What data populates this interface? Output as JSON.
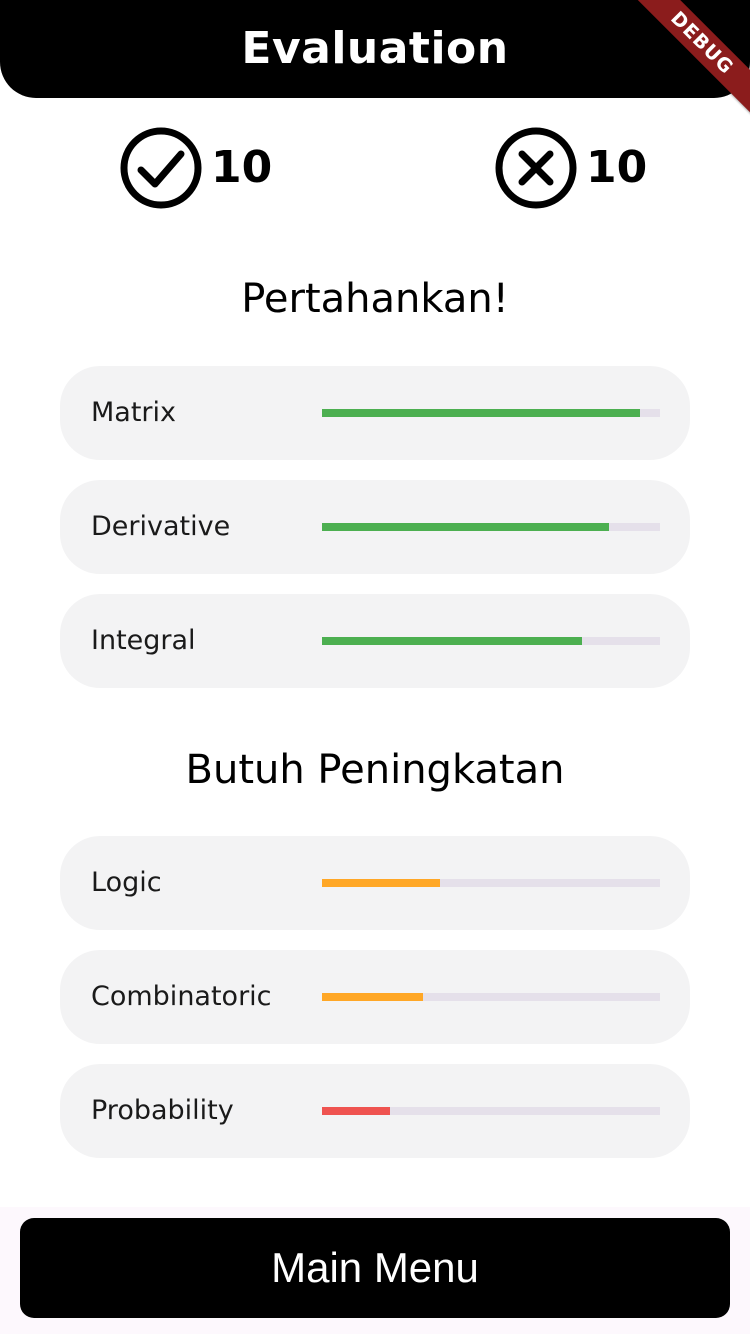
{
  "header": {
    "title": "Evaluation"
  },
  "debug_banner": "DEBUG",
  "scores": {
    "correct": {
      "icon": "check-circle-icon",
      "count": "10"
    },
    "wrong": {
      "icon": "x-circle-icon",
      "count": "10"
    }
  },
  "sections": {
    "strong": {
      "title": "Pertahankan!",
      "topics": [
        {
          "label": "Matrix",
          "progress": 0.94,
          "color": "#4caf50"
        },
        {
          "label": "Derivative",
          "progress": 0.85,
          "color": "#4caf50"
        },
        {
          "label": "Integral",
          "progress": 0.77,
          "color": "#4caf50"
        }
      ]
    },
    "weak": {
      "title": "Butuh Peningkatan",
      "topics": [
        {
          "label": "Logic",
          "progress": 0.35,
          "color": "#ffa726"
        },
        {
          "label": "Combinatoric",
          "progress": 0.3,
          "color": "#ffa726"
        },
        {
          "label": "Probability",
          "progress": 0.2,
          "color": "#ef5350"
        }
      ]
    }
  },
  "colors": {
    "track": "#e5e0ea",
    "card": "#f3f3f4",
    "header": "#000000"
  },
  "footer": {
    "main_menu_label": "Main Menu"
  }
}
